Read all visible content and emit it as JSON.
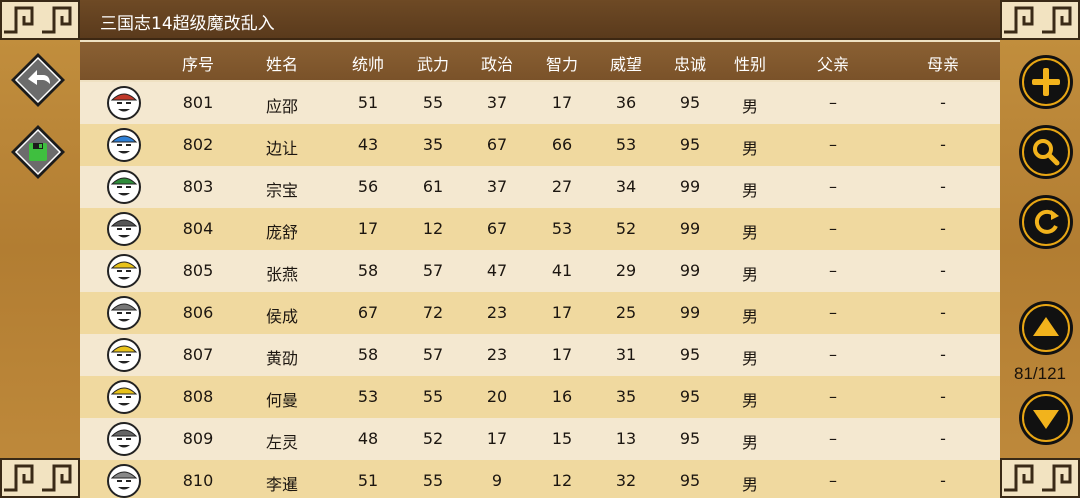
{
  "title": "三国志14超级魔改乱入",
  "columns": [
    "序号",
    "姓名",
    "统帅",
    "武力",
    "政治",
    "智力",
    "威望",
    "忠诚",
    "性别",
    "父亲",
    "母亲"
  ],
  "rows": [
    {
      "id": "801",
      "name": "应邵",
      "lead": "51",
      "war": "55",
      "pol": "37",
      "int": "17",
      "fame": "36",
      "loy": "95",
      "sex": "男",
      "father": "–",
      "mother": "-",
      "hat": "#c0392b"
    },
    {
      "id": "802",
      "name": "边让",
      "lead": "43",
      "war": "35",
      "pol": "67",
      "int": "66",
      "fame": "53",
      "loy": "95",
      "sex": "男",
      "father": "–",
      "mother": "-",
      "hat": "#2d7fd6"
    },
    {
      "id": "803",
      "name": "宗宝",
      "lead": "56",
      "war": "61",
      "pol": "37",
      "int": "27",
      "fame": "34",
      "loy": "99",
      "sex": "男",
      "father": "–",
      "mother": "-",
      "hat": "#2e8b3a"
    },
    {
      "id": "804",
      "name": "庞舒",
      "lead": "17",
      "war": "12",
      "pol": "67",
      "int": "53",
      "fame": "52",
      "loy": "99",
      "sex": "男",
      "father": "–",
      "mother": "-",
      "hat": "#555555"
    },
    {
      "id": "805",
      "name": "张燕",
      "lead": "58",
      "war": "57",
      "pol": "47",
      "int": "41",
      "fame": "29",
      "loy": "99",
      "sex": "男",
      "father": "–",
      "mother": "-",
      "hat": "#e8c21a"
    },
    {
      "id": "806",
      "name": "侯成",
      "lead": "67",
      "war": "72",
      "pol": "23",
      "int": "17",
      "fame": "25",
      "loy": "99",
      "sex": "男",
      "father": "–",
      "mother": "-",
      "hat": "#777777"
    },
    {
      "id": "807",
      "name": "黄劭",
      "lead": "58",
      "war": "57",
      "pol": "23",
      "int": "17",
      "fame": "31",
      "loy": "95",
      "sex": "男",
      "father": "–",
      "mother": "-",
      "hat": "#e8c21a"
    },
    {
      "id": "808",
      "name": "何曼",
      "lead": "53",
      "war": "55",
      "pol": "20",
      "int": "16",
      "fame": "35",
      "loy": "95",
      "sex": "男",
      "father": "–",
      "mother": "-",
      "hat": "#e8c21a"
    },
    {
      "id": "809",
      "name": "左灵",
      "lead": "48",
      "war": "52",
      "pol": "17",
      "int": "15",
      "fame": "13",
      "loy": "95",
      "sex": "男",
      "father": "–",
      "mother": "-",
      "hat": "#666666"
    },
    {
      "id": "810",
      "name": "李暹",
      "lead": "51",
      "war": "55",
      "pol": "9",
      "int": "12",
      "fame": "32",
      "loy": "95",
      "sex": "男",
      "father": "–",
      "mother": "-",
      "hat": "#888888"
    }
  ],
  "pagination": {
    "text": "81/121"
  },
  "buttons": {
    "back": "back-arrow-icon",
    "save": "save-icon",
    "add": "plus-icon",
    "search": "search-icon",
    "refresh": "refresh-icon",
    "page_up": "triangle-up-icon",
    "page_down": "triangle-down-icon"
  },
  "colors": {
    "title_bar": "#5a3a1c",
    "header_row": "#7a5229",
    "row_odd": "#f4e8d0",
    "row_even": "#f0d99f",
    "panel": "#b37f35"
  }
}
